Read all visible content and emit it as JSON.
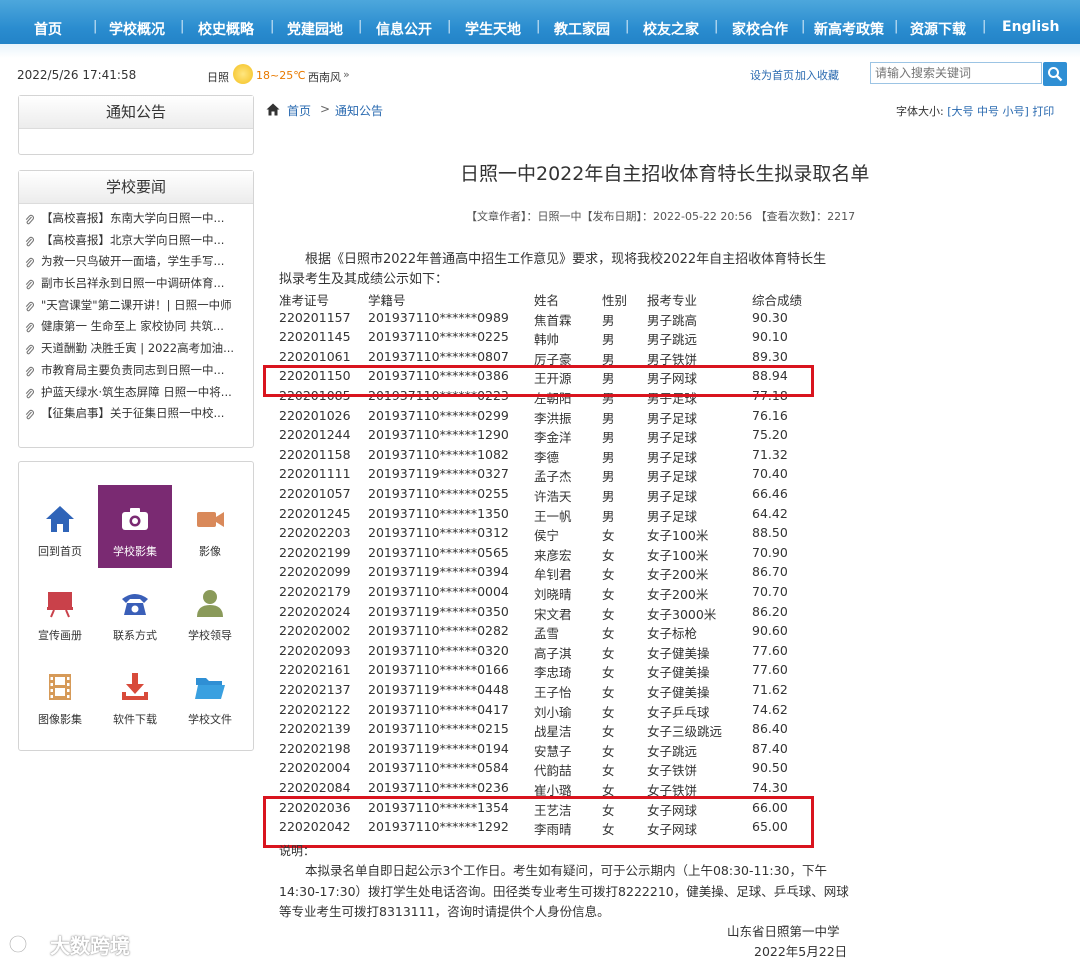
{
  "nav": {
    "items": [
      "首页",
      "学校概况",
      "校史概略",
      "党建园地",
      "信息公开",
      "学生天地",
      "教工家园",
      "校友之家",
      "家校合作",
      "新高考政策",
      "资源下载",
      "English"
    ]
  },
  "topbar": {
    "datetime": "2022/5/26 17:41:58",
    "city": "日照",
    "temp": "18~25℃",
    "wind": "西南风",
    "wind_arrow": "»",
    "set_home": "设为首页",
    "add_fav": "加入收藏",
    "search_placeholder": "请输入搜索关键词"
  },
  "sidebar": {
    "notice_title": "通知公告",
    "news_title": "学校要闻",
    "news": [
      "【高校喜报】东南大学向日照一中...",
      "【高校喜报】北京大学向日照一中...",
      "为救一只鸟破开一面墙，学生手写...",
      "副市长吕祥永到日照一中调研体育...",
      "\"天宫课堂\"第二课开讲！| 日照一中师",
      "健康第一 生命至上 家校协同 共筑...",
      "天道酬勤 决胜壬寅 | 2022高考加油...",
      "市教育局主要负责同志到日照一中...",
      "护蓝天绿水·筑生态屏障 日照一中将...",
      "【征集启事】关于征集日照一中校..."
    ],
    "quick_links": [
      {
        "label": "回到首页",
        "icon": "home-icon"
      },
      {
        "label": "学校影集",
        "icon": "camera-icon"
      },
      {
        "label": "影像",
        "icon": "video-camera-icon"
      },
      {
        "label": "宣传画册",
        "icon": "presentation-board-icon"
      },
      {
        "label": "联系方式",
        "icon": "telephone-icon"
      },
      {
        "label": "学校领导",
        "icon": "person-icon"
      },
      {
        "label": "图像影集",
        "icon": "film-strip-icon"
      },
      {
        "label": "软件下载",
        "icon": "download-icon"
      },
      {
        "label": "学校文件",
        "icon": "folder-icon"
      }
    ]
  },
  "breadcrumb": {
    "home": "首页",
    "sep": ">",
    "current": "通知公告"
  },
  "font_size": {
    "label": "字体大小:",
    "open": "[",
    "large": "大号",
    "medium": "中号",
    "small": "小号",
    "close": "]",
    "print": "打印"
  },
  "article": {
    "title": "日照一中2022年自主招收体育特长生拟录取名单",
    "meta": "【文章作者】：日照一中【发布日期】：2022-05-22 20:56 【查看次数】：2217",
    "intro": "根据《日照市2022年普通高中招生工作意见》要求，现将我校2022年自主招收体育特长生拟录考生及其成绩公示如下：",
    "headers": [
      "准考证号",
      "学籍号",
      "姓名",
      "性别",
      "报考专业",
      "综合成绩"
    ],
    "rows": [
      [
        "220201157",
        "201937110******0989",
        "焦首霖",
        "男",
        "男子跳高",
        "90.30"
      ],
      [
        "220201145",
        "201937110******0225",
        "韩帅",
        "男",
        "男子跳远",
        "90.10"
      ],
      [
        "220201061",
        "201937110******0807",
        "厉子豪",
        "男",
        "男子铁饼",
        "89.30"
      ],
      [
        "220201150",
        "201937110******0386",
        "王开源",
        "男",
        "男子网球",
        "88.94"
      ],
      [
        "220201085",
        "201937110******0223",
        "左朝阳",
        "男",
        "男子足球",
        "77.18"
      ],
      [
        "220201026",
        "201937110******0299",
        "李洪振",
        "男",
        "男子足球",
        "76.16"
      ],
      [
        "220201244",
        "201937110******1290",
        "李金洋",
        "男",
        "男子足球",
        "75.20"
      ],
      [
        "220201158",
        "201937110******1082",
        "李德",
        "男",
        "男子足球",
        "71.32"
      ],
      [
        "220201111",
        "201937119******0327",
        "孟子杰",
        "男",
        "男子足球",
        "70.40"
      ],
      [
        "220201057",
        "201937110******0255",
        "许浩天",
        "男",
        "男子足球",
        "66.46"
      ],
      [
        "220201245",
        "201937110******1350",
        "王一帆",
        "男",
        "男子足球",
        "64.42"
      ],
      [
        "220202203",
        "201937110******0312",
        "侯宁",
        "女",
        "女子100米",
        "88.50"
      ],
      [
        "220202199",
        "201937110******0565",
        "来彦宏",
        "女",
        "女子100米",
        "70.90"
      ],
      [
        "220202099",
        "201937119******0394",
        "牟钊君",
        "女",
        "女子200米",
        "86.70"
      ],
      [
        "220202179",
        "201937110******0004",
        "刘晓晴",
        "女",
        "女子200米",
        "70.70"
      ],
      [
        "220202024",
        "201937119******0350",
        "宋文君",
        "女",
        "女子3000米",
        "86.20"
      ],
      [
        "220202002",
        "201937110******0282",
        "孟雪",
        "女",
        "女子标枪",
        "90.60"
      ],
      [
        "220202093",
        "201937110******0320",
        "高子淇",
        "女",
        "女子健美操",
        "77.60"
      ],
      [
        "220202161",
        "201937110******0166",
        "李忠琦",
        "女",
        "女子健美操",
        "77.60"
      ],
      [
        "220202137",
        "201937119******0448",
        "王子怡",
        "女",
        "女子健美操",
        "71.62"
      ],
      [
        "220202122",
        "201937110******0417",
        "刘小瑜",
        "女",
        "女子乒乓球",
        "74.62"
      ],
      [
        "220202139",
        "201937110******0215",
        "战星洁",
        "女",
        "女子三级跳远",
        "86.40"
      ],
      [
        "220202198",
        "201937119******0194",
        "安慧子",
        "女",
        "女子跳远",
        "87.40"
      ],
      [
        "220202004",
        "201937110******0584",
        "代韵喆",
        "女",
        "女子铁饼",
        "90.50"
      ],
      [
        "220202084",
        "201937110******0236",
        "崔小璐",
        "女",
        "女子铁饼",
        "74.30"
      ],
      [
        "220202036",
        "201937110******1354",
        "王艺洁",
        "女",
        "女子网球",
        "66.00"
      ],
      [
        "220202042",
        "201937110******1292",
        "李雨晴",
        "女",
        "女子网球",
        "65.00"
      ]
    ],
    "notes_label": "说明：",
    "notes": "本拟录名单自即日起公示3个工作日。考生如有疑问，可于公示期内（上午08:30-11:30，下午14:30-17:30）拨打学生处电话咨询。田径类专业考生可拨打8222210，健美操、足球、乒乓球、网球等专业考生可拨打8313111，咨询时请提供个人身份信息。",
    "signature": "山东省日照第一中学",
    "date": "2022年5月22日"
  },
  "watermark": "大数跨境",
  "colors": {
    "nav": "#2a8ccf",
    "link": "#2a6ab0",
    "highlight": "#d9141e",
    "active_tile": "#7a2a72"
  }
}
